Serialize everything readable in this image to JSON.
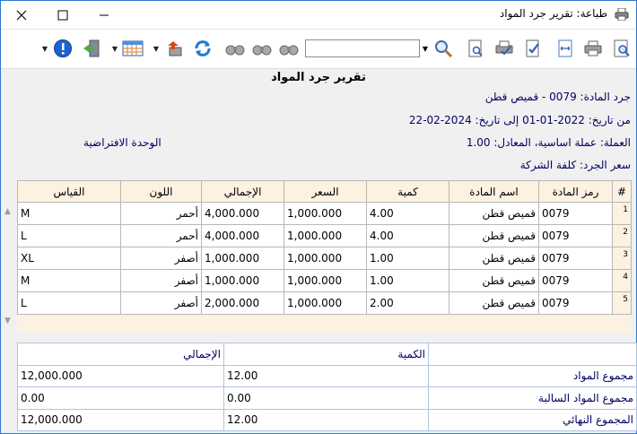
{
  "window": {
    "title": "طباعة: تقرير جرد المواد"
  },
  "toolbar": {
    "search_value": "",
    "icons": [
      "print-preview-icon",
      "print-icon",
      "page-width-icon",
      "check-doc-icon",
      "print-check-icon",
      "doc-search-icon",
      "zoom-icon",
      "binoculars-icon",
      "binoculars-prev-icon",
      "binoculars-next-icon",
      "refresh-icon",
      "export-icon",
      "grid-icon",
      "exit-icon",
      "help-icon"
    ]
  },
  "report": {
    "title": "تقرير جرد المواد",
    "item_line": "جرد المادة: 0079 - قميص قطن",
    "date_line": "من تاريخ: 2022-01-01 إلى تاريخ: 2024-02-22",
    "currency_line": "العملة: عملة اساسية، المعادل: 1.00",
    "unit_line": "الوحدة الافتراضية",
    "price_line": "سعر الجرد: كلفة الشركة"
  },
  "grid": {
    "headers": {
      "idx": "#",
      "code": "رمز المادة",
      "name": "اسم المادة",
      "qty": "كمية",
      "price": "السعر",
      "total": "الإجمالي",
      "color": "اللون",
      "size": "القياس"
    },
    "rows": [
      {
        "idx": "1",
        "code": "0079",
        "name": "قميص قطن",
        "qty": "4.00",
        "price": "1,000.000",
        "total": "4,000.000",
        "color": "أحمر",
        "size": "M"
      },
      {
        "idx": "2",
        "code": "0079",
        "name": "قميص قطن",
        "qty": "4.00",
        "price": "1,000.000",
        "total": "4,000.000",
        "color": "أحمر",
        "size": "L"
      },
      {
        "idx": "3",
        "code": "0079",
        "name": "قميص قطن",
        "qty": "1.00",
        "price": "1,000.000",
        "total": "1,000.000",
        "color": "أصفر",
        "size": "XL"
      },
      {
        "idx": "4",
        "code": "0079",
        "name": "قميص قطن",
        "qty": "1.00",
        "price": "1,000.000",
        "total": "1,000.000",
        "color": "أصفر",
        "size": "M"
      },
      {
        "idx": "5",
        "code": "0079",
        "name": "قميص قطن",
        "qty": "2.00",
        "price": "1,000.000",
        "total": "2,000.000",
        "color": "أصفر",
        "size": "L"
      }
    ]
  },
  "totals": {
    "qty_header": "الكمية",
    "total_header": "الإجمالي",
    "rows": [
      {
        "label": "مجموع المواد",
        "qty": "12.00",
        "total": "12,000.000"
      },
      {
        "label": "مجموع المواد السالبة",
        "qty": "0.00",
        "total": "0.00"
      },
      {
        "label": "المجموع النهائي",
        "qty": "12.00",
        "total": "12,000.000"
      }
    ]
  }
}
